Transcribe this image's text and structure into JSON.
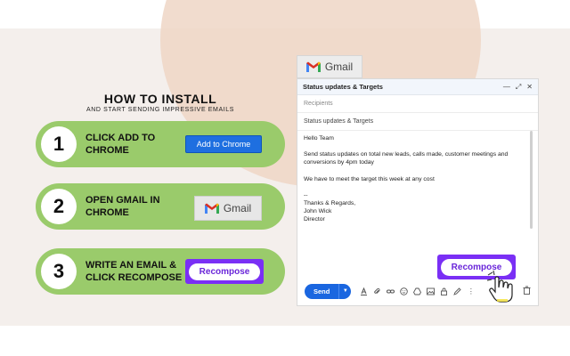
{
  "heading": {
    "title": "HOW TO INSTALL",
    "subtitle": "AND START SENDING IMPRESSIVE EMAILS"
  },
  "steps": [
    {
      "number": "1",
      "text": "CLICK ADD TO CHROME",
      "button_label": "Add to Chrome"
    },
    {
      "number": "2",
      "text": "OPEN  GMAIL IN CHROME",
      "badge_label": "Gmail"
    },
    {
      "number": "3",
      "text": "WRITE AN EMAIL & CLICK RECOMPOSE",
      "button_label": "Recompose"
    }
  ],
  "gmail_tag": {
    "label": "Gmail"
  },
  "composer": {
    "window_title": "Status updates & Targets",
    "recipients_placeholder": "Recipients",
    "subject": "Status updates & Targets",
    "body": {
      "greeting": "Hello Team",
      "line1": "Send status updates on total new leads, calls made, customer meetings and conversions by 4pm today",
      "line2": "We have to meet the target this week at any cost",
      "sep": "--",
      "sig1": "Thanks & Regards,",
      "sig2": "John Wick",
      "sig3": "Director"
    },
    "send_label": "Send",
    "recompose_label": "Recompose"
  },
  "colors": {
    "accent_green": "#9acb6b",
    "accent_purple": "#7a2ff5",
    "send_blue": "#1a66e0",
    "chrome_blue": "#1e6fe0"
  },
  "icons": [
    "minimize-icon",
    "expand-icon",
    "close-icon",
    "format-text-icon",
    "attach-icon",
    "link-icon",
    "emoji-icon",
    "drive-icon",
    "image-icon",
    "lock-icon",
    "pen-icon",
    "more-icon",
    "trash-icon",
    "hand-cursor-icon",
    "gmail-logo-icon"
  ]
}
